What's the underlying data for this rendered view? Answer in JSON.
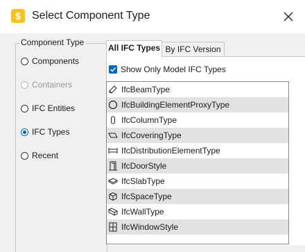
{
  "window": {
    "title": "Select Component Type",
    "app_icon": "app-s-icon",
    "close_icon": "close-icon"
  },
  "component_group": {
    "legend": "Component Type",
    "options": [
      {
        "label": "Components",
        "selected": false,
        "disabled": false
      },
      {
        "label": "Containers",
        "selected": false,
        "disabled": true
      },
      {
        "label": "IFC Entities",
        "selected": false,
        "disabled": false
      },
      {
        "label": "IFC Types",
        "selected": true,
        "disabled": false
      },
      {
        "label": "Recent",
        "selected": false,
        "disabled": false
      }
    ]
  },
  "tabs": [
    {
      "label": "All IFC Types",
      "active": true
    },
    {
      "label": "By IFC Version",
      "active": false
    }
  ],
  "filter": {
    "label": "Show Only Model IFC Types",
    "checked": true
  },
  "ifc_types": [
    {
      "label": "IfcBeamType",
      "icon": "beam-icon"
    },
    {
      "label": "IfcBuildingElementProxyType",
      "icon": "proxy-circle-icon"
    },
    {
      "label": "IfcColumnType",
      "icon": "column-icon"
    },
    {
      "label": "IfcCoveringType",
      "icon": "covering-icon"
    },
    {
      "label": "IfcDistributionElementType",
      "icon": "distribution-icon"
    },
    {
      "label": "IfcDoorStyle",
      "icon": "door-icon"
    },
    {
      "label": "IfcSlabType",
      "icon": "slab-icon"
    },
    {
      "label": "IfcSpaceType",
      "icon": "space-icon"
    },
    {
      "label": "IfcWallType",
      "icon": "wall-icon"
    },
    {
      "label": "IfcWindowStyle",
      "icon": "window-icon"
    }
  ],
  "colors": {
    "accent": "#0067c0",
    "app_icon": "#f6c21c",
    "alt_row": "#e1e1e1"
  }
}
